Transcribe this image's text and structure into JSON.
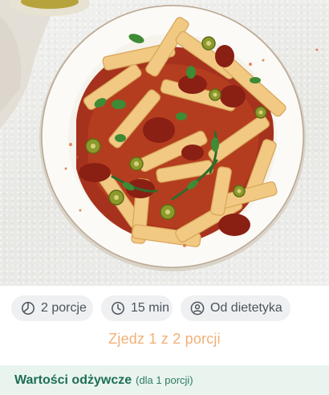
{
  "recipe_image": {
    "alt": ""
  },
  "meta": {
    "portions": {
      "icon": "portions-pie-icon",
      "label": "2 porcje"
    },
    "time": {
      "icon": "clock-icon",
      "label": "15 min"
    },
    "author": {
      "icon": "person-icon",
      "label": "Od dietetyka"
    }
  },
  "portion_note": "Zjedz 1 z 2 porcji",
  "nutrition": {
    "title": "Wartości odżywcze",
    "subtitle": "(dla 1 porcji)"
  },
  "colors": {
    "chip_bg": "#eef0f2",
    "chip_text": "#4c545c",
    "accent_orange": "#f2b074",
    "nutrition_bg": "#e9f4ef",
    "nutrition_text": "#1f6e55"
  }
}
